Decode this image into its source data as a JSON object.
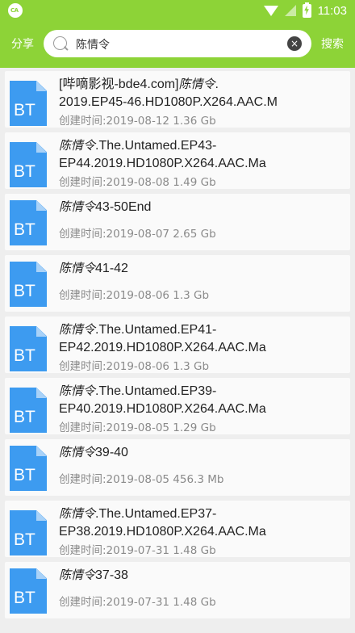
{
  "status_bar": {
    "app_badge": "CA",
    "time": "11:03"
  },
  "header": {
    "share_label": "分享",
    "search": {
      "value": "陈情令",
      "placeholder": ""
    },
    "clear_icon": "×",
    "search_button": "搜索"
  },
  "icon_label": "BT",
  "results": [
    {
      "keyword": "",
      "title": "[哔嘀影视-bde4.com]陈情令.2019.EP45-46.HD1080P.X264.AAC.M",
      "line1_prefix": "[哔嘀影视-bde4.com]",
      "line1_keyword": "陈情令",
      "line1_suffix": ".",
      "line2": "2019.EP45-46.HD1080P.X264.AAC.M",
      "meta": "创建时间:2019-08-12 1.36 Gb"
    },
    {
      "line1_prefix": "",
      "line1_keyword": "陈情令",
      "line1_suffix": ".The.Untamed.EP43-",
      "line2": "EP44.2019.HD1080P.X264.AAC.Ma",
      "meta": "创建时间:2019-08-08 1.49 Gb"
    },
    {
      "line1_prefix": "",
      "line1_keyword": "陈情令",
      "line1_suffix": "43-50End",
      "line2": "",
      "meta": "创建时间:2019-08-07 2.65 Gb"
    },
    {
      "line1_prefix": "",
      "line1_keyword": "陈情令",
      "line1_suffix": "41-42",
      "line2": "",
      "meta": "创建时间:2019-08-06 1.3 Gb"
    },
    {
      "line1_prefix": "",
      "line1_keyword": "陈情令",
      "line1_suffix": ".The.Untamed.EP41-",
      "line2": "EP42.2019.HD1080P.X264.AAC.Ma",
      "meta": "创建时间:2019-08-06 1.3 Gb"
    },
    {
      "line1_prefix": "",
      "line1_keyword": "陈情令",
      "line1_suffix": ".The.Untamed.EP39-",
      "line2": "EP40.2019.HD1080P.X264.AAC.Ma",
      "meta": "创建时间:2019-08-05 1.29 Gb"
    },
    {
      "line1_prefix": "",
      "line1_keyword": "陈情令",
      "line1_suffix": "39-40",
      "line2": "",
      "meta": "创建时间:2019-08-05 456.3 Mb"
    },
    {
      "line1_prefix": "",
      "line1_keyword": "陈情令",
      "line1_suffix": ".The.Untamed.EP37-",
      "line2": "EP38.2019.HD1080P.X264.AAC.Ma",
      "meta": "创建时间:2019-07-31 1.48 Gb"
    },
    {
      "line1_prefix": "",
      "line1_keyword": "陈情令",
      "line1_suffix": "37-38",
      "line2": "",
      "meta": "创建时间:2019-07-31 1.48 Gb"
    }
  ]
}
